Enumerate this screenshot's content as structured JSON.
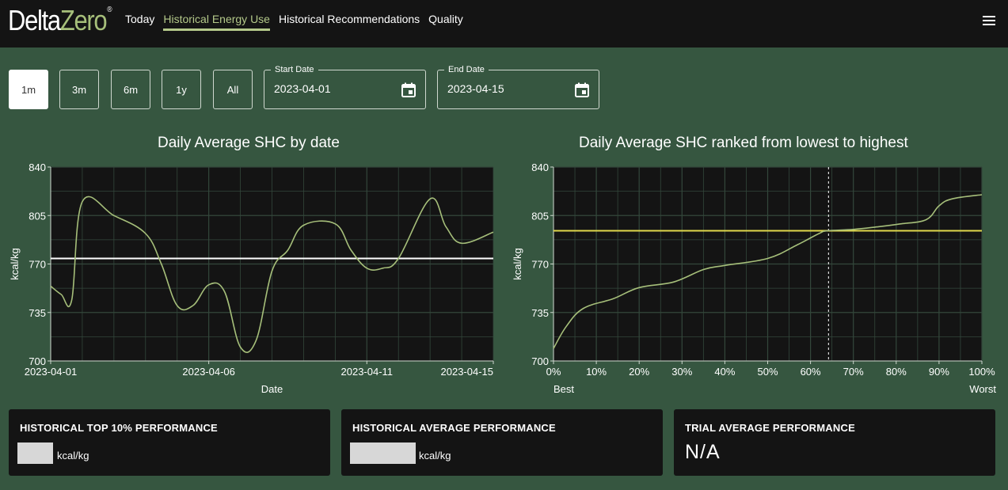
{
  "app": {
    "logo_delta": "Delta",
    "logo_zero": "Zero",
    "logo_mark": "®"
  },
  "nav": {
    "items": [
      "Today",
      "Historical Energy Use",
      "Historical Recommendations",
      "Quality"
    ],
    "active": "Historical Energy Use",
    "menu_icon": "hamburger-menu-icon"
  },
  "range_buttons": {
    "items": [
      "1m",
      "3m",
      "6m",
      "1y",
      "All"
    ],
    "selected": "1m"
  },
  "start_date": {
    "label": "Start Date",
    "value": "2023-04-01",
    "icon": "calendar-icon"
  },
  "end_date": {
    "label": "End Date",
    "value": "2023-04-15",
    "icon": "calendar-icon"
  },
  "colors": {
    "background": "#365640",
    "panel": "#141414",
    "accent": "#b4c98a",
    "series": "#a6bf7a",
    "reference_yellow": "#e0d84c"
  },
  "chart_data": [
    {
      "type": "line",
      "title": "Daily Average SHC by date",
      "xlabel": "Date",
      "ylabel": "kcal/kg",
      "x_ticks": [
        "2023-04-01",
        "2023-04-06",
        "2023-04-11",
        "2023-04-15"
      ],
      "y_ticks": [
        700,
        735,
        770,
        805,
        840
      ],
      "ylim": [
        700,
        840
      ],
      "xlim": [
        "2023-04-01",
        "2023-04-15"
      ],
      "grid": true,
      "x": [
        "2023-04-01",
        "2023-04-01",
        "2023-04-01",
        "2023-04-02",
        "2023-04-03",
        "2023-04-04",
        "2023-04-04",
        "2023-04-05",
        "2023-04-05",
        "2023-04-06",
        "2023-04-06",
        "2023-04-07",
        "2023-04-07",
        "2023-04-08",
        "2023-04-08",
        "2023-04-09",
        "2023-04-10",
        "2023-04-10",
        "2023-04-11",
        "2023-04-11",
        "2023-04-12",
        "2023-04-13",
        "2023-04-13",
        "2023-04-14",
        "2023-04-15"
      ],
      "values": [
        754,
        748,
        744,
        815,
        805,
        792,
        770,
        740,
        740,
        755,
        750,
        710,
        715,
        765,
        780,
        798,
        799,
        780,
        767,
        767,
        774,
        817,
        797,
        785,
        793
      ],
      "reference_line": {
        "value": 774,
        "color": "#ffffff"
      }
    },
    {
      "type": "line",
      "title": "Daily Average SHC ranked from lowest to highest",
      "xlabel_left": "Best",
      "xlabel_right": "Worst",
      "ylabel": "kcal/kg",
      "x_ticks": [
        "0%",
        "10%",
        "20%",
        "30%",
        "40%",
        "50%",
        "60%",
        "70%",
        "80%",
        "90%",
        "100%"
      ],
      "y_ticks": [
        700,
        735,
        770,
        805,
        840
      ],
      "ylim": [
        700,
        840
      ],
      "xlim": [
        0,
        100
      ],
      "grid": true,
      "x": [
        0,
        3,
        7,
        14,
        20,
        28,
        35,
        40,
        50,
        57,
        62,
        64,
        70,
        76,
        81,
        87,
        90,
        93,
        100
      ],
      "values": [
        709,
        725,
        738,
        745,
        753,
        757,
        766,
        769,
        774,
        784,
        792,
        794,
        795,
        797,
        799,
        802,
        812,
        817,
        820
      ],
      "reference_line": {
        "value": 794,
        "color": "#e0d84c"
      },
      "marker_line_x": 64.2
    }
  ],
  "cards": [
    {
      "title": "HISTORICAL TOP 10% PERFORMANCE",
      "unit": "kcal/kg"
    },
    {
      "title": "HISTORICAL AVERAGE PERFORMANCE",
      "unit": "kcal/kg"
    },
    {
      "title": "TRIAL AVERAGE PERFORMANCE",
      "value": "N/A"
    }
  ]
}
